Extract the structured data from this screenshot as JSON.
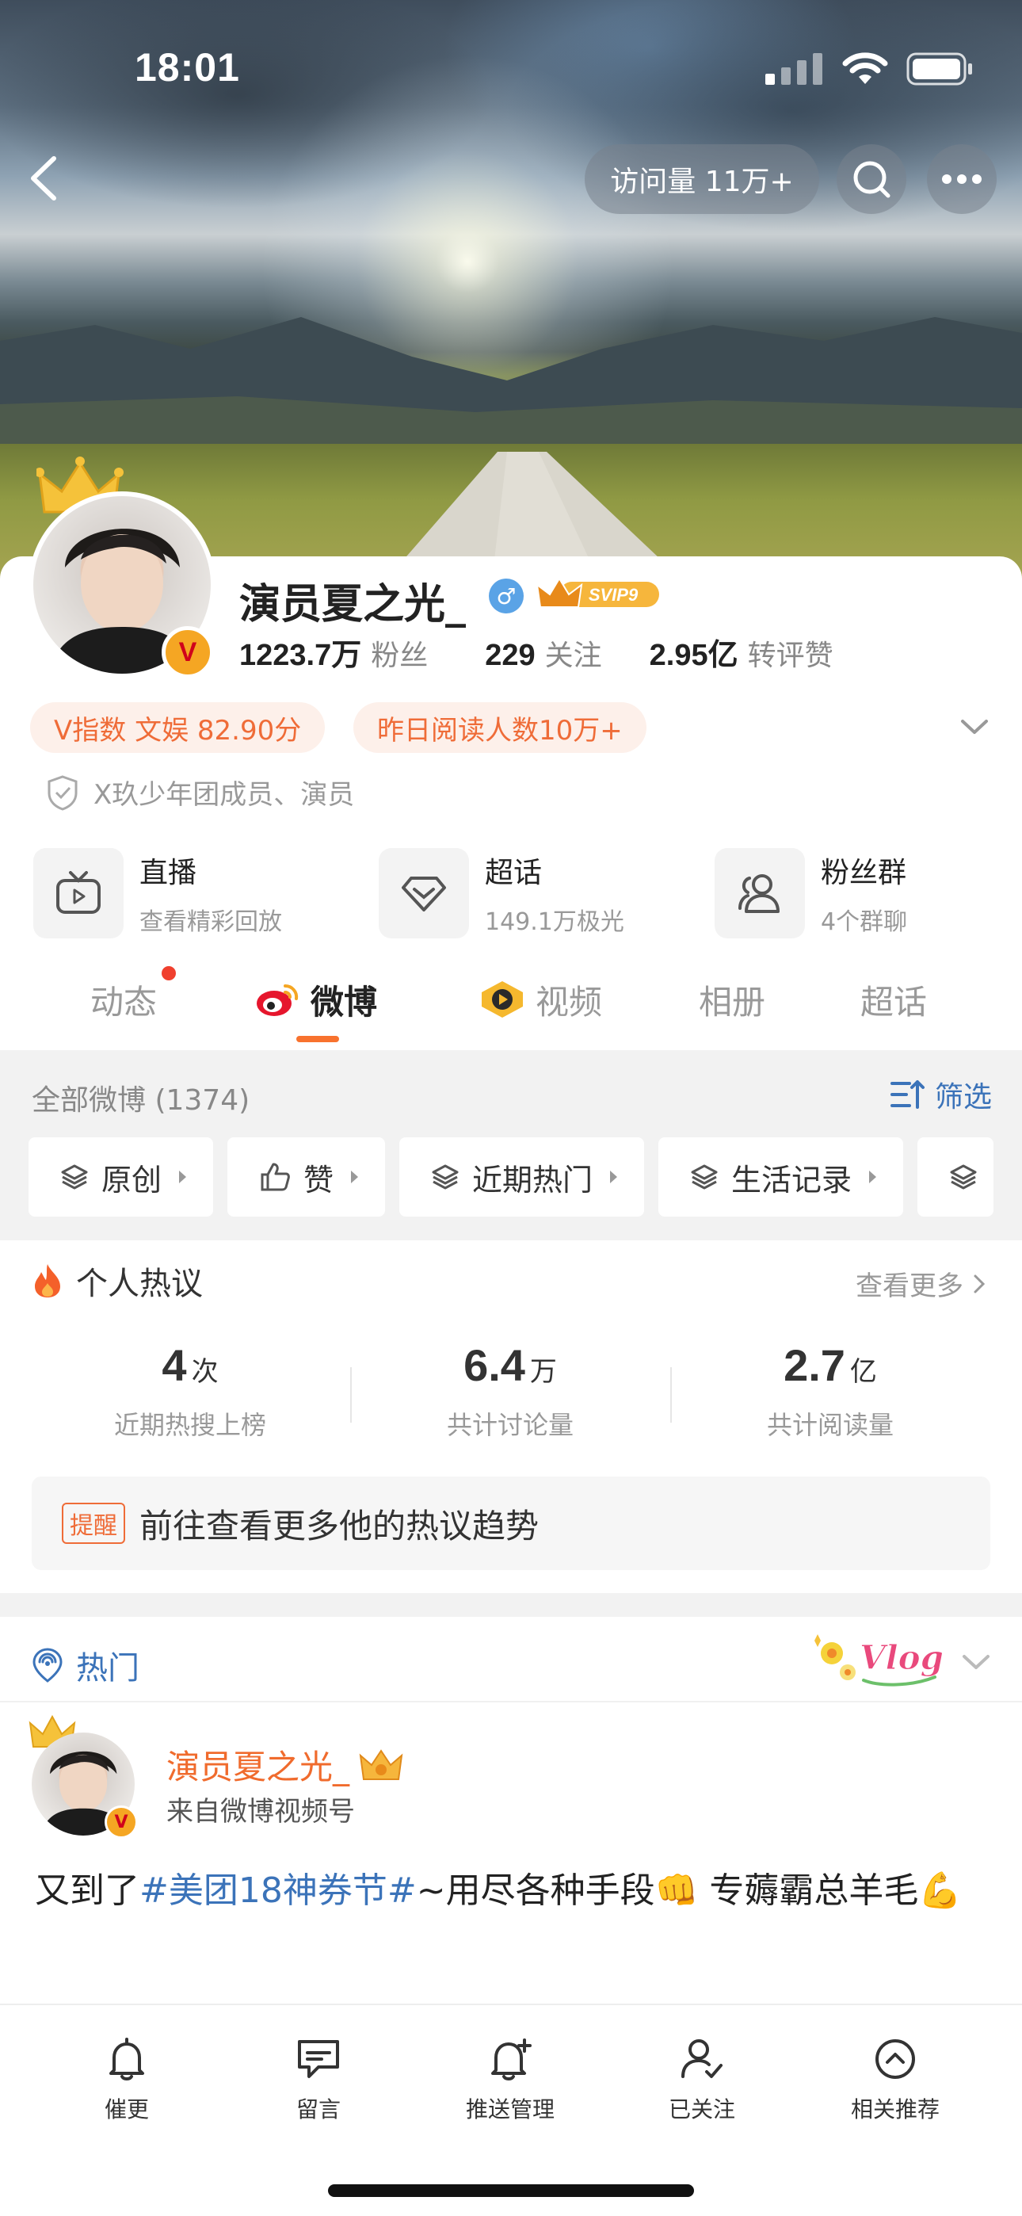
{
  "status_bar": {
    "time": "18:01"
  },
  "header": {
    "visit_count": "访问量 11万+"
  },
  "profile": {
    "name": "演员夏之光_",
    "gender_symbol": "♂",
    "svip_label": "SVIP9",
    "verified_mark": "V",
    "stats": [
      {
        "value": "1223.7万",
        "label": "粉丝"
      },
      {
        "value": "229",
        "label": "关注"
      },
      {
        "value": "2.95亿",
        "label": "转评赞"
      }
    ],
    "chips": [
      "V指数 文娱 82.90分",
      "昨日阅读人数10万+"
    ],
    "intro": "X玖少年团成员、演员"
  },
  "quick_links": [
    {
      "title": "直播",
      "sub": "查看精彩回放",
      "icon": "tv-icon"
    },
    {
      "title": "超话",
      "sub": "149.1万极光",
      "icon": "diamond-icon"
    },
    {
      "title": "粉丝群",
      "sub": "4个群聊",
      "icon": "group-icon"
    }
  ],
  "tabs": [
    {
      "label": "动态",
      "has_dot": true
    },
    {
      "label": "微博",
      "active": true
    },
    {
      "label": "视频"
    },
    {
      "label": "相册"
    },
    {
      "label": "超话"
    }
  ],
  "feed_filter": {
    "all_label": "全部微博 (1374)",
    "filter_label": "筛选",
    "chips": [
      "原创",
      "赞",
      "近期热门",
      "生活记录"
    ]
  },
  "hot_discussion": {
    "title": "个人热议",
    "more": "查看更多",
    "stats": [
      {
        "value": "4",
        "unit": "次",
        "label": "近期热搜上榜"
      },
      {
        "value": "6.4",
        "unit": "万",
        "label": "共计讨论量"
      },
      {
        "value": "2.7",
        "unit": "亿",
        "label": "共计阅读量"
      }
    ],
    "remind_tag": "提醒",
    "remind_text": "前往查看更多他的热议趋势"
  },
  "hot_feed": {
    "label": "热门",
    "vlog_text": "Vlog"
  },
  "post": {
    "author": "演员夏之光_",
    "source": "来自微博视频号",
    "text_prefix": "又到了",
    "topic": "#美团18神券节#",
    "text_suffix": "~用尽各种手段👊 专薅霸总羊毛💪"
  },
  "bottom_bar": [
    {
      "label": "催更",
      "icon": "bell-icon"
    },
    {
      "label": "留言",
      "icon": "message-icon"
    },
    {
      "label": "推送管理",
      "icon": "bell-plus-icon"
    },
    {
      "label": "已关注",
      "icon": "user-check-icon"
    },
    {
      "label": "相关推荐",
      "icon": "up-circle-icon"
    }
  ],
  "colors": {
    "accent": "#f8722e",
    "link": "#3b73b9",
    "chip_bg": "#fdf0ea"
  }
}
